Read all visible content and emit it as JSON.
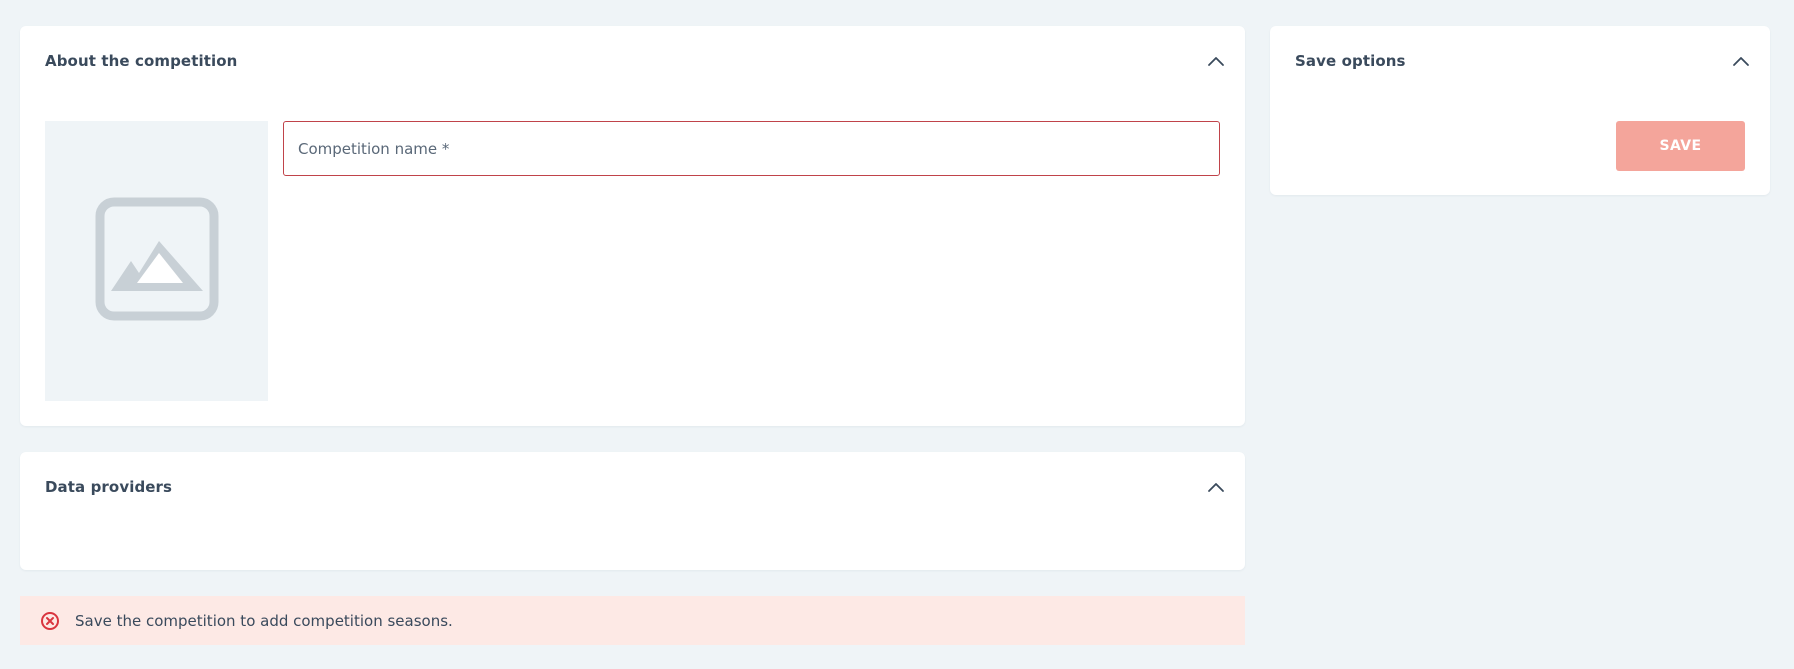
{
  "about_card": {
    "title": "About the competition",
    "name_placeholder": "Competition name *",
    "name_value": ""
  },
  "save_card": {
    "title": "Save options",
    "save_label": "SAVE"
  },
  "providers_card": {
    "title": "Data providers"
  },
  "alert": {
    "message": "Save the competition to add competition seasons."
  },
  "colors": {
    "background": "#eff4f7",
    "card": "#ffffff",
    "input_error_border": "#c0434a",
    "save_button_disabled": "#f4a59b",
    "alert_background": "#fde9e5",
    "alert_icon": "#d9353f",
    "image_placeholder_icon": "#c8d0d6"
  },
  "icons": {
    "collapse": "chevron-up-icon",
    "image_placeholder": "image-icon",
    "alert": "error-circle-icon"
  }
}
